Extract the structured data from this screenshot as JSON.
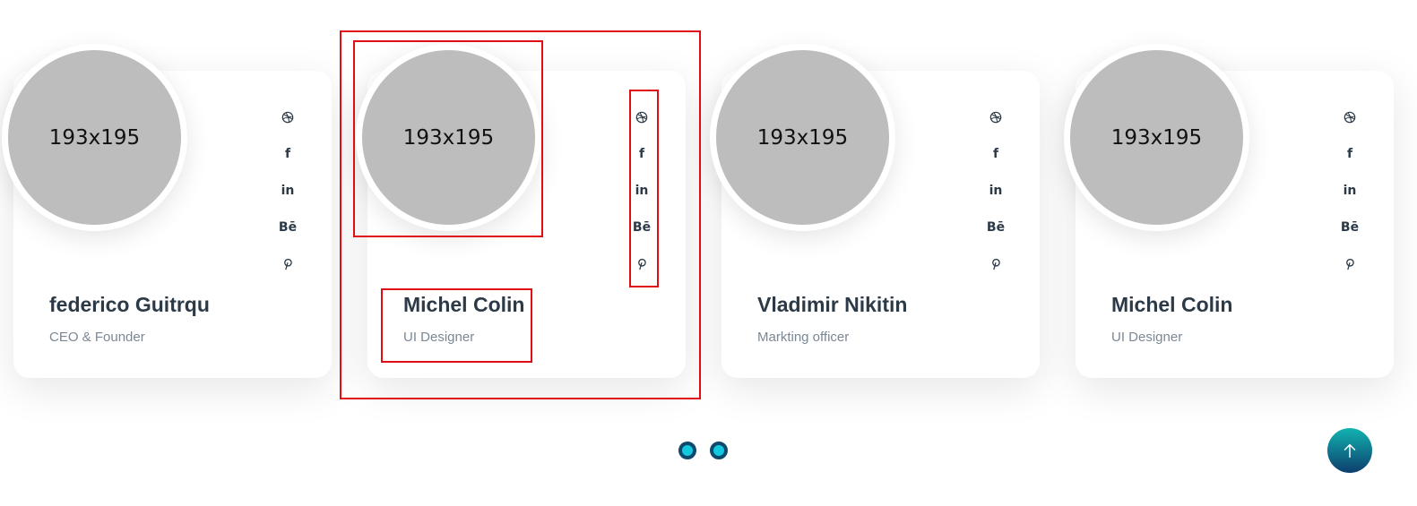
{
  "team": [
    {
      "image_label": "193x195",
      "name": "federico Guitrqu",
      "role": "CEO & Founder",
      "socials": {
        "facebook": "f",
        "linkedin": "in",
        "behance": "Bē"
      }
    },
    {
      "image_label": "193x195",
      "name": "Michel Colin",
      "role": "UI Designer",
      "socials": {
        "facebook": "f",
        "linkedin": "in",
        "behance": "Bē"
      }
    },
    {
      "image_label": "193x195",
      "name": "Vladimir Nikitin",
      "role": "Markting officer",
      "socials": {
        "facebook": "f",
        "linkedin": "in",
        "behance": "Bē"
      }
    },
    {
      "image_label": "193x195",
      "name": "Michel Colin",
      "role": "UI Designer",
      "socials": {
        "facebook": "f",
        "linkedin": "in",
        "behance": "Bē"
      }
    }
  ],
  "pagination": {
    "dot_count": 2
  },
  "colors": {
    "accent": "#12c9e0",
    "dark": "#0f4a6e",
    "text": "#2c3a48",
    "muted": "#7b8794",
    "highlight": "#e10d14"
  },
  "icons": [
    "dribbble-icon",
    "facebook-icon",
    "linkedin-icon",
    "behance-icon",
    "pinterest-icon",
    "arrow-up-icon"
  ]
}
